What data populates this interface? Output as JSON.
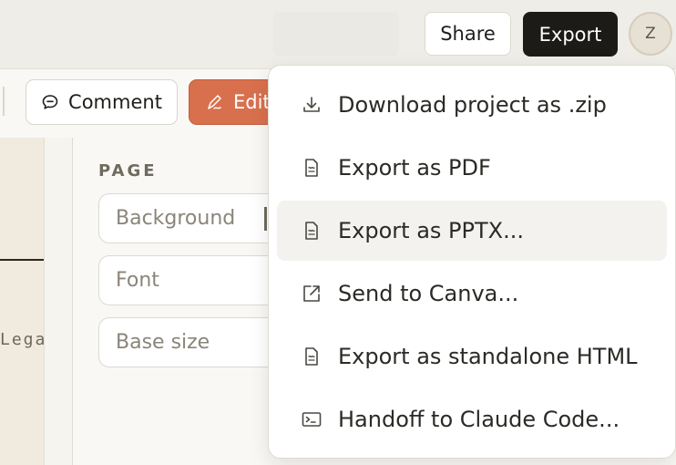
{
  "header": {
    "share_label": "Share",
    "export_label": "Export",
    "avatar_initial": "Z"
  },
  "toolbar": {
    "comment_label": "Comment",
    "edit_label": "Edit"
  },
  "canvas": {
    "partial_text": "Lega"
  },
  "panel": {
    "section_title": "PAGE",
    "fields": [
      {
        "label": "Background"
      },
      {
        "label": "Font"
      },
      {
        "label": "Base size"
      }
    ]
  },
  "export_menu": {
    "highlighted_index": 2,
    "items": [
      {
        "label": "Download project as .zip",
        "icon": "download-icon"
      },
      {
        "label": "Export as PDF",
        "icon": "document-icon"
      },
      {
        "label": "Export as PPTX...",
        "icon": "document-icon"
      },
      {
        "label": "Send to Canva...",
        "icon": "external-link-icon"
      },
      {
        "label": "Export as standalone HTML",
        "icon": "document-icon"
      },
      {
        "label": "Handoff to Claude Code...",
        "icon": "terminal-icon"
      }
    ]
  }
}
